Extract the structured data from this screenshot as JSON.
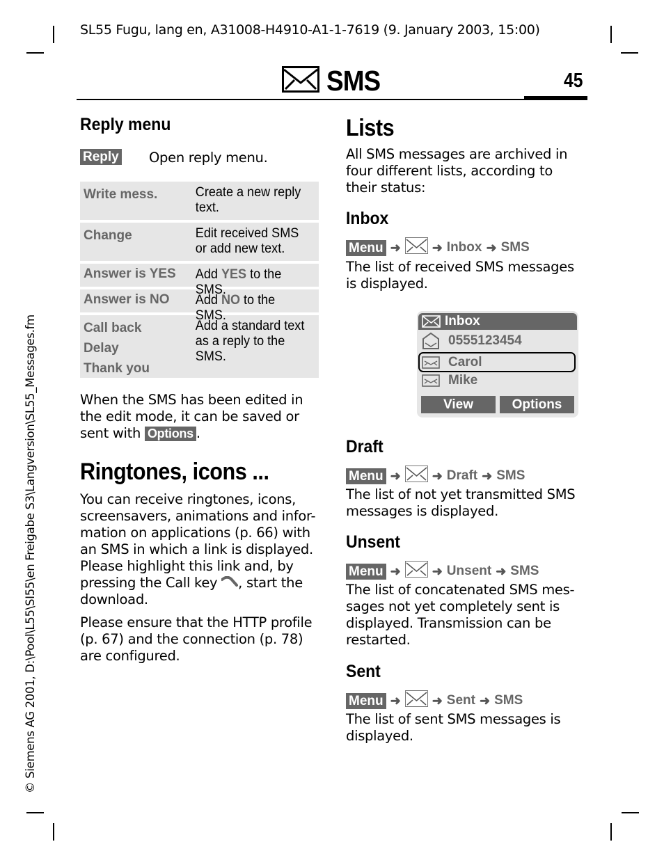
{
  "header": {
    "doc_info": "SL55 Fugu, lang en, A31008-H4910-A1-1-7619 (9. January 2003, 15:00)",
    "chapter_title": "SMS",
    "chapter_icon": "envelope-icon",
    "page_number": "45"
  },
  "side_note": "© Siemens AG 2001, D:\\Pool\\L55\\SI55\\en Freigabe S3\\Langversion\\SL55_Messages.fm",
  "reply_menu": {
    "heading": "Reply menu",
    "key_label": "Reply",
    "key_desc": "Open reply menu.",
    "table": [
      {
        "options": [
          "Write mess."
        ],
        "desc": [
          "Create a new reply text."
        ]
      },
      {
        "options": [
          "Change"
        ],
        "desc": [
          "Edit received SMS or add new text."
        ]
      },
      {
        "options": [
          "Answer is YES"
        ],
        "desc_pre": "Add ",
        "desc_key": "YES",
        "desc_post": " to the SMS."
      },
      {
        "options": [
          "Answer is NO"
        ],
        "desc_pre": "Add ",
        "desc_key": "NO",
        "desc_post": " to the SMS."
      },
      {
        "options": [
          "Call back",
          "Delay",
          "Thank you"
        ],
        "desc": [
          "Add a standard text as a reply to the SMS."
        ]
      }
    ],
    "after_text_pre": "When the SMS has been edited in the edit mode, it can be saved or sent with ",
    "after_text_key": "Options",
    "after_text_post": "."
  },
  "ringtones": {
    "heading": "Ringtones, icons ...",
    "para1_pre": "You can receive ringtones, icons, screensavers, animations and infor-mation on applications (p. 66) with an SMS in which a link is displayed. Please highlight this link and, by pressing the Call key ",
    "para1_post": ", start the download.",
    "call_key_icon": "call-key-icon",
    "para2": "Please ensure that the HTTP profile (p. 67) and the connection (p. 78) are configured."
  },
  "lists": {
    "heading": "Lists",
    "intro": "All SMS messages are archived in four different lists, according to their status:",
    "menu_key": "Menu",
    "arrow": "➜",
    "sections": [
      {
        "heading": "Inbox",
        "path": [
          "Inbox",
          "SMS"
        ],
        "text": "The list of received SMS messages is displayed."
      },
      {
        "heading": "Draft",
        "path": [
          "Draft",
          "SMS"
        ],
        "text": "The list of not yet transmitted SMS messages is displayed."
      },
      {
        "heading": "Unsent",
        "path": [
          "Unsent",
          "SMS"
        ],
        "text": "The list of concatenated SMS mes-sages not yet completely sent is displayed. Transmission can be restarted."
      },
      {
        "heading": "Sent",
        "path": [
          "Sent",
          "SMS"
        ],
        "text": "The list of sent SMS messages is displayed."
      }
    ]
  },
  "phone_screen": {
    "title": "Inbox",
    "items": [
      {
        "label": "0555123454",
        "icon": "unread-envelope-icon",
        "selected": false
      },
      {
        "label": "Carol",
        "icon": "read-envelope-icon",
        "selected": true
      },
      {
        "label": "Mike",
        "icon": "read-envelope-icon",
        "selected": false
      }
    ],
    "softkeys": [
      "View",
      "Options"
    ]
  }
}
